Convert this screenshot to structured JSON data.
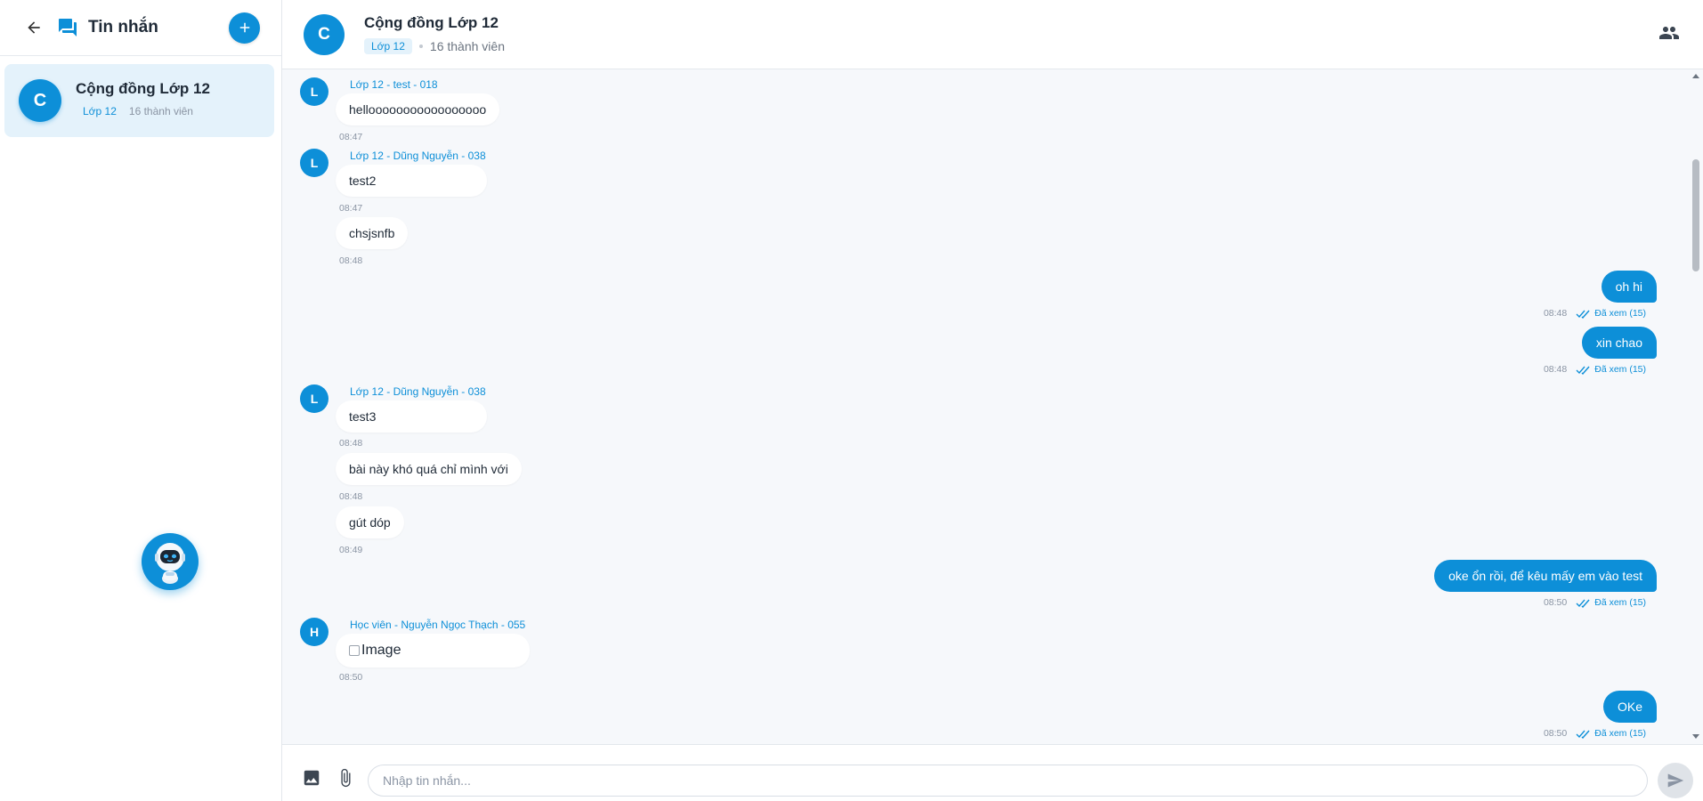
{
  "sidebar": {
    "title": "Tin nhắn",
    "conversation": {
      "avatar_letter": "C",
      "name": "Cộng đồng Lớp 12",
      "tag": "Lớp 12",
      "members": "16 thành viên"
    }
  },
  "chat": {
    "avatar_letter": "C",
    "name": "Cộng đồng Lớp 12",
    "tag": "Lớp 12",
    "members": "16 thành viên"
  },
  "messages": {
    "m1": {
      "avatar": "L",
      "sender": "Lớp 12 - test - 018",
      "text": "hellooooooooooooooooo",
      "time": "08:47"
    },
    "m2": {
      "avatar": "L",
      "sender": "Lớp 12 - Dũng Nguyễn - 038",
      "text": "test2",
      "time": "08:47"
    },
    "m3": {
      "text": "chsjsnfb",
      "time": "08:48"
    },
    "m4": {
      "text": "oh hi",
      "time": "08:48",
      "seen": "Đã xem (15)"
    },
    "m5": {
      "text": "xin chao",
      "time": "08:48",
      "seen": "Đã xem (15)"
    },
    "m6": {
      "avatar": "L",
      "sender": "Lớp 12 - Dũng Nguyễn - 038",
      "text": "test3",
      "time": "08:48"
    },
    "m7": {
      "text": "bài này khó quá chỉ mình với",
      "time": "08:48"
    },
    "m8": {
      "text": "gút dóp",
      "time": "08:49"
    },
    "m9": {
      "text": "oke ổn rồi, để kêu mấy em vào test",
      "time": "08:50",
      "seen": "Đã xem (15)"
    },
    "m10": {
      "avatar": "H",
      "sender": "Học viên - Nguyễn Ngọc Thạch - 055",
      "image_alt": "Image",
      "time": "08:50"
    },
    "m11": {
      "text": "OKe",
      "time": "08:50",
      "seen": "Đã xem (15)"
    }
  },
  "composer": {
    "placeholder": "Nhập tin nhắn...",
    "value": ""
  },
  "colors": {
    "accent": "#0d8fd8",
    "chat_background": "#f6f8fb",
    "selected_item": "#e4f2fb"
  },
  "icons": [
    "arrow-left-icon",
    "chat-icon",
    "plus-icon",
    "robot-icon",
    "people-icon",
    "image-icon",
    "attachment-icon",
    "send-icon",
    "double-check-icon"
  ]
}
